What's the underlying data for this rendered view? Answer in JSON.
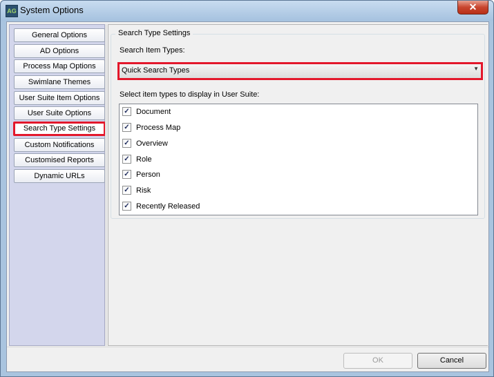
{
  "window": {
    "title": "System Options",
    "icon": "app-logo-icon",
    "icon_text": "AG",
    "close_glyph": "✕"
  },
  "sidebar": {
    "items": [
      {
        "label": "General Options",
        "selected": false
      },
      {
        "label": "AD Options",
        "selected": false
      },
      {
        "label": "Process Map Options",
        "selected": false
      },
      {
        "label": "Swimlane Themes",
        "selected": false
      },
      {
        "label": "User Suite Item Options",
        "selected": false
      },
      {
        "label": "User Suite Options",
        "selected": false
      },
      {
        "label": "Search Type Settings",
        "selected": true
      },
      {
        "label": "Custom Notifications",
        "selected": false
      },
      {
        "label": "Customised Reports",
        "selected": false
      },
      {
        "label": "Dynamic URLs",
        "selected": false
      }
    ]
  },
  "settings": {
    "group_title": "Search Type Settings",
    "item_types_label": "Search Item Types:",
    "item_types_value": "Quick Search Types",
    "display_label": "Select item types to display in User Suite:",
    "item_types": [
      {
        "label": "Document",
        "checked": true
      },
      {
        "label": "Process Map",
        "checked": true
      },
      {
        "label": "Overview",
        "checked": true
      },
      {
        "label": "Role",
        "checked": true
      },
      {
        "label": "Person",
        "checked": true
      },
      {
        "label": "Risk",
        "checked": true
      },
      {
        "label": "Recently Released",
        "checked": true
      }
    ]
  },
  "footer": {
    "ok_label": "OK",
    "ok_enabled": false,
    "cancel_label": "Cancel"
  },
  "colors": {
    "highlight": "#e3172b",
    "sidebar_bg": "#d3d6ec",
    "title_bar": "#a6c2df"
  }
}
